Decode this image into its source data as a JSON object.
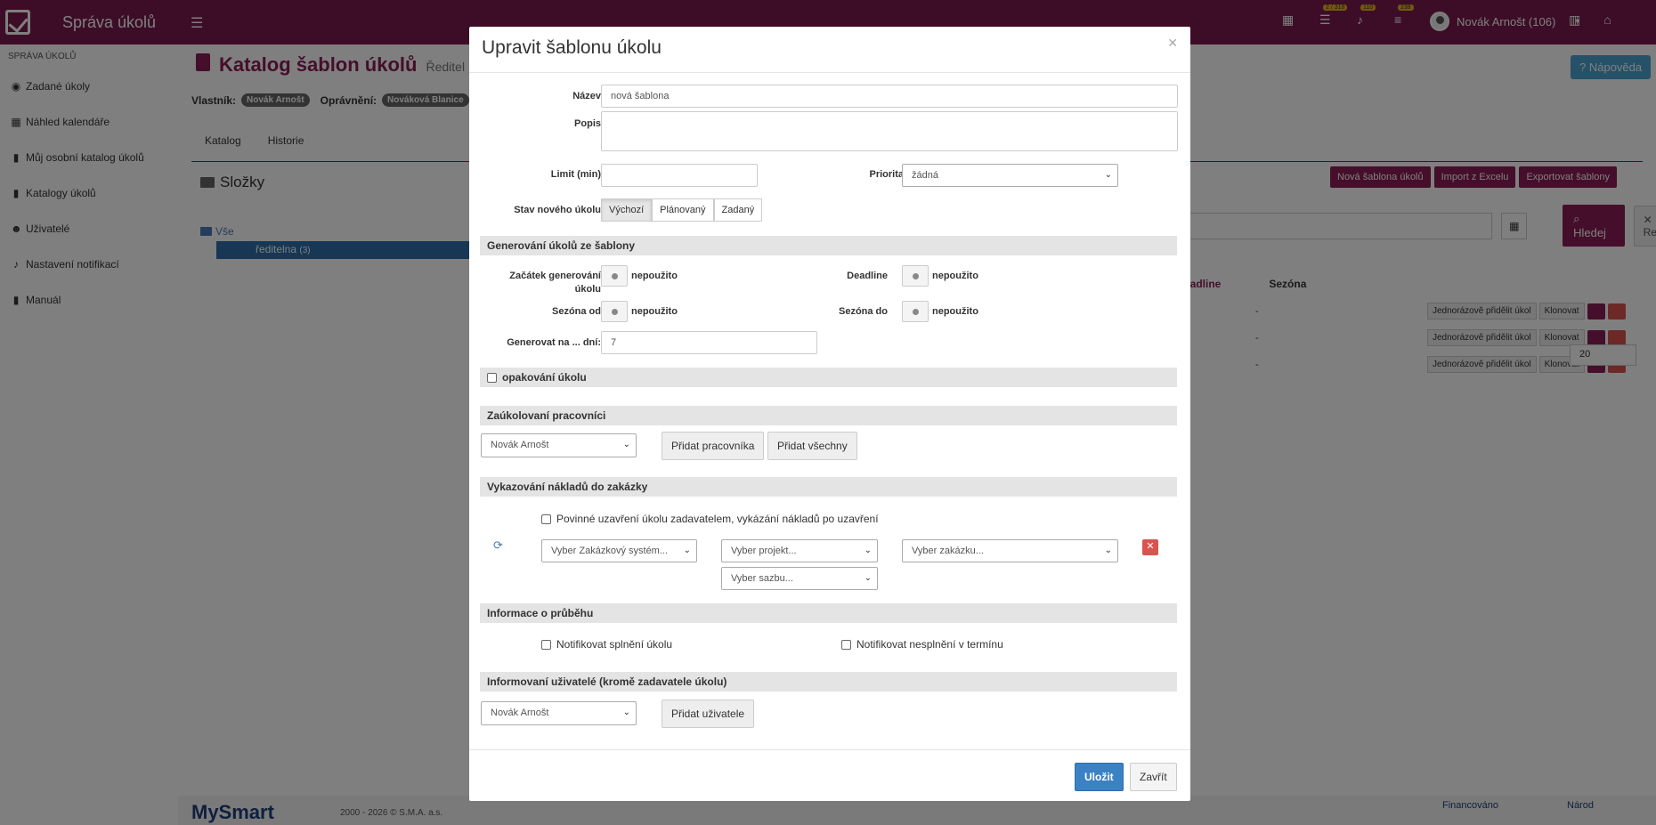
{
  "app": {
    "brand": "Správa úkolů",
    "badges": [
      "2 / 318",
      "110",
      "238"
    ],
    "user": "Novák Arnošt (106)"
  },
  "sidebar": {
    "section": "SPRÁVA ÚKOLŮ",
    "items": [
      {
        "label": "Zadané úkoly"
      },
      {
        "label": "Náhled kalendáře"
      },
      {
        "label": "Můj osobní katalog úkolů"
      },
      {
        "label": "Katalogy úkolů"
      },
      {
        "label": "Uživatelé"
      },
      {
        "label": "Nastavení notifikací"
      },
      {
        "label": "Manuál"
      }
    ]
  },
  "page": {
    "title": "Katalog šablon úkolů",
    "subtitle": "Ředitel",
    "help": "Nápověda",
    "owner_label": "Vlastník:",
    "owner": "Novák Arnošt",
    "perm_label": "Oprávnění:",
    "perm": "Nováková Blanice",
    "tabs": [
      "Katalog",
      "Historie"
    ],
    "folders_title": "Složky",
    "tree_all": "Vše",
    "tree_selected": "ředitelna",
    "tree_selected_count": "(3)",
    "toolbar": [
      "Nová šablona úkolů",
      "Import z Excelu",
      "Exportovat šablony"
    ],
    "search_btn": "Hledej",
    "reset_btn": "Reset",
    "col_deadline": "eadline",
    "col_season": "Sezóna",
    "row_dash": "-",
    "row_assign": "Jednorázově přidělit úkol",
    "row_clone": "Klonovat",
    "page_size": "20",
    "footer_logo": "MySmart",
    "footer_copy": "2000 - 2026 © S.M.A. a.s.",
    "footer_eu": "Financováno",
    "footer_narod": "Národ"
  },
  "modal": {
    "title": "Upravit šablonu úkolu",
    "name_label": "Název",
    "name_value": "nová šablona",
    "desc_label": "Popis",
    "limit_label": "Limit (min)",
    "priority_label": "Priorita",
    "priority_value": "žádná",
    "state_label": "Stav nového úkolu",
    "states": [
      "Výchozí",
      "Plánovaný",
      "Zadaný"
    ],
    "gen_section": "Generování úkolů ze šablony",
    "gen_start_label": "Začátek generování úkolu",
    "deadline_label": "Deadline",
    "season_from_label": "Sezóna od",
    "season_to_label": "Sezóna do",
    "unused": "nepoužito",
    "gen_days_label": "Generovat na ... dní:",
    "gen_days_value": "7",
    "repeat_section": "opakování úkolu",
    "workers_section": "Zaúkolovaní pracovníci",
    "worker_select": "Novák Arnošt",
    "add_worker": "Přidat pracovníka",
    "add_all": "Přidat všechny",
    "costs_section": "Vykazování nákladů do zakázky",
    "costs_check": "Povinné uzavření úkolu zadavatelem, vykázání nákladů po uzavření",
    "sel_system": "Vyber Zakázkový systém...",
    "sel_project": "Vyber projekt...",
    "sel_order": "Vyber zakázku...",
    "sel_rate": "Vyber sazbu...",
    "progress_section": "Informace o průběhu",
    "notify_done": "Notifikovat splnění úkolu",
    "notify_late": "Notifikovat nesplnění v termínu",
    "inform_section": "Informovaní uživatelé (kromě zadavatele úkolu)",
    "inform_select": "Novák Arnošt",
    "add_user": "Přidat uživatele",
    "save": "Uložit",
    "close": "Zavřít"
  }
}
